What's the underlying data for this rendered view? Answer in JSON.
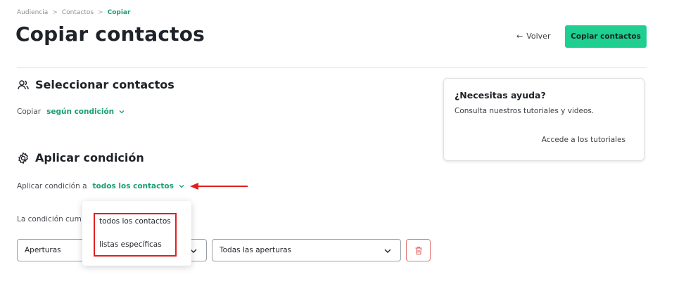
{
  "breadcrumb": [
    "Audiencia",
    "Contactos",
    "Copiar"
  ],
  "page_title": "Copiar contactos",
  "header": {
    "back_label": "Volver",
    "primary_label": "Copiar contactos"
  },
  "select_section": {
    "title": "Seleccionar contactos",
    "copy_prefix": "Copiar",
    "copy_mode": "según condición"
  },
  "condition_section": {
    "title": "Aplicar condición",
    "apply_prefix": "Aplicar condición a",
    "apply_target": "todos los contactos",
    "condition_text": "La condición cum",
    "field_select": "Aperturas",
    "value_select": "Todas las aperturas"
  },
  "dropdown": {
    "options": [
      "todos los contactos",
      "listas específicas"
    ]
  },
  "help": {
    "title": "¿Necesitas ayuda?",
    "description": "Consulta nuestros tutoriales y videos.",
    "link": "Accede a los tutoriales"
  },
  "colors": {
    "accent": "#1fcf92",
    "link_green": "#1a9e74",
    "annotation_red": "#e02020"
  }
}
